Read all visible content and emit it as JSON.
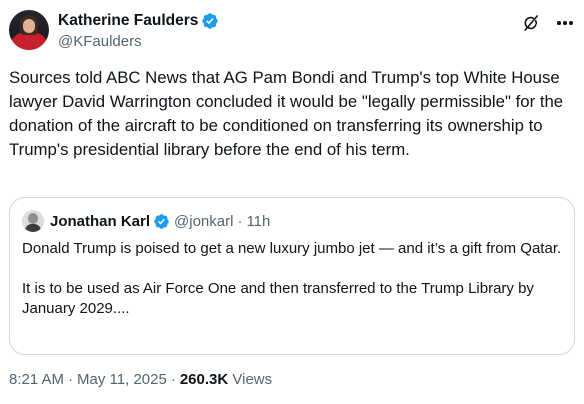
{
  "author": {
    "display_name": "Katherine Faulders",
    "handle": "@KFaulders",
    "verified": true,
    "verified_color": "#1d9bf0"
  },
  "icons": {
    "grok": "grok-icon",
    "more": "more-options-icon",
    "verified": "verified-badge-icon"
  },
  "tweet": {
    "text": "Sources told ABC News that AG Pam Bondi and Trump's top White House lawyer David Warrington concluded it would be \"legally permissible\" for the donation of the aircraft to be conditioned on transferring its ownership to Trump's presidential library before the end of his term."
  },
  "quoted": {
    "display_name": "Jonathan Karl",
    "handle": "@jonkarl",
    "separator": "·",
    "time": "11h",
    "verified": true,
    "paragraph_1": "Donald Trump is poised to get a new luxury jumbo jet — and it’s a gift from Qatar.",
    "paragraph_2": "It is to be used as Air Force One and then transferred to the Trump Library by January 2029...."
  },
  "meta": {
    "time": "8:21 AM",
    "separator": "·",
    "date": "May 11, 2025",
    "views_count": "260.3K",
    "views_label": "Views"
  },
  "colors": {
    "text": "#0f1419",
    "secondary": "#536471",
    "border": "#cfd9de",
    "accent": "#1d9bf0"
  }
}
